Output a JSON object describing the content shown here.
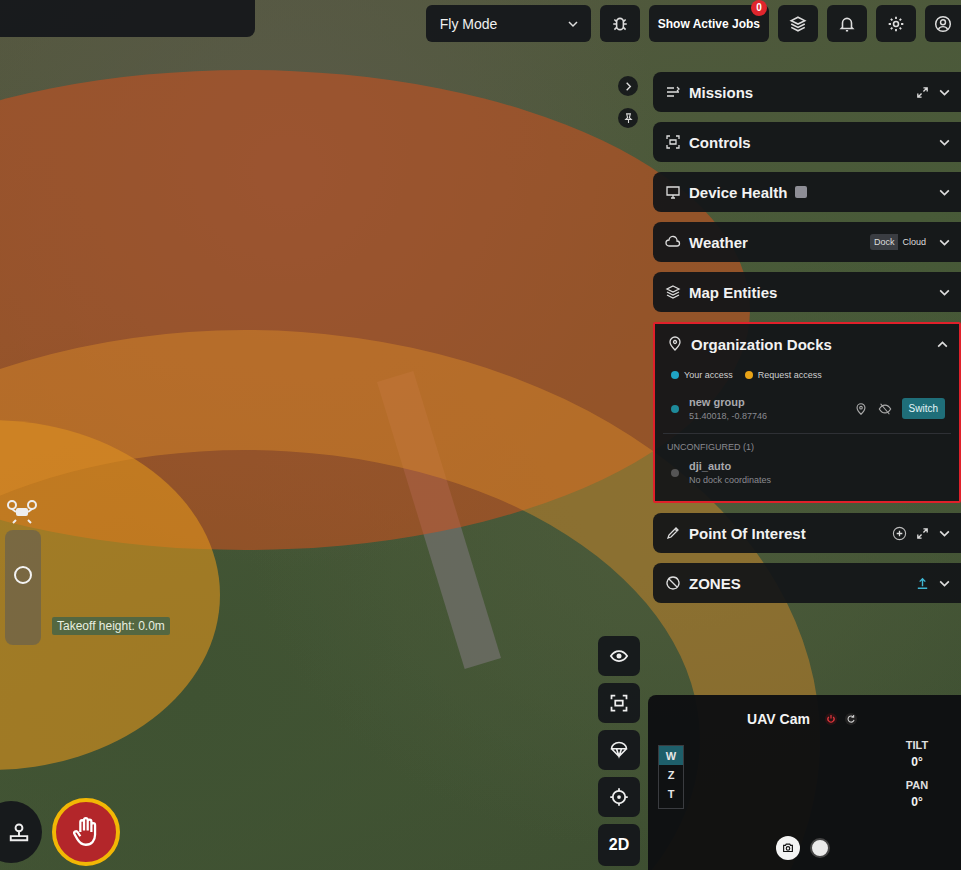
{
  "top_bar": {
    "mode": "Fly Mode",
    "jobs_button": "Show Active Jobs",
    "jobs_badge": "0"
  },
  "map": {
    "zones": [
      {
        "kind": "fill",
        "color": "#d2501e"
      },
      {
        "kind": "fill",
        "color": "#e0951c"
      },
      {
        "kind": "ring",
        "color": "#dc8c28"
      }
    ],
    "takeoff_label": "Takeoff height: 0.0m"
  },
  "panel": {
    "sections": [
      {
        "title": "Missions",
        "kind": "expandable",
        "expanded": false
      },
      {
        "title": "Controls",
        "kind": "plain",
        "expanded": false
      },
      {
        "title": "Device Health",
        "kind": "health",
        "expanded": false
      },
      {
        "title": "Weather",
        "kind": "weather",
        "expanded": false
      },
      {
        "title": "Map Entities",
        "kind": "plain",
        "expanded": false
      },
      {
        "title": "Organization Docks",
        "kind": "docks",
        "expanded": true
      },
      {
        "title": "Point Of Interest",
        "kind": "poi",
        "expanded": false
      },
      {
        "title": "ZONES",
        "kind": "zones",
        "expanded": false
      }
    ]
  },
  "weather_sources": [
    {
      "label": "Dock",
      "selected": true
    },
    {
      "label": "Cloud",
      "selected": false
    }
  ],
  "docks": {
    "legend": [
      {
        "label": "Your access",
        "color": "#1fa3c4"
      },
      {
        "label": "Request access",
        "color": "#e8a317"
      }
    ],
    "items": [
      {
        "name": "new group",
        "coords": "51.40018, -0.87746",
        "action": "Switch",
        "color": "#1e8a9a"
      }
    ],
    "unconfigured_heading": "UNCONFIGURED (1)",
    "unconfigured": [
      {
        "name": "dji_auto",
        "detail": "No dock coordinates",
        "color": "#555555"
      }
    ]
  },
  "map_tool_label": "2D",
  "camera": {
    "title": "UAV Cam",
    "zoom_modes": [
      {
        "label": "W",
        "selected": true
      },
      {
        "label": "Z",
        "selected": false
      },
      {
        "label": "T",
        "selected": false
      }
    ],
    "readings": [
      {
        "label": "TILT",
        "value": "0°"
      },
      {
        "label": "PAN",
        "value": "0°"
      }
    ]
  }
}
